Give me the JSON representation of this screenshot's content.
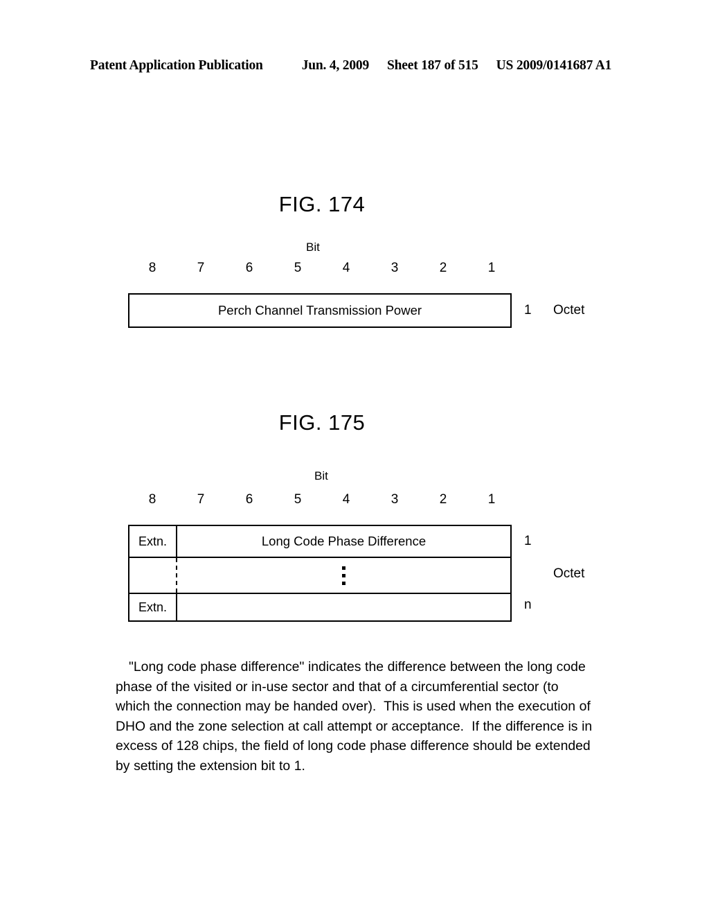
{
  "header": {
    "title": "Patent Application Publication",
    "date": "Jun. 4, 2009",
    "sheet": "Sheet 187 of 515",
    "patent_number": "US 2009/0141687 A1"
  },
  "figures": [
    {
      "id": "fig-174",
      "title": "FIG. 174",
      "bit_label": "Bit",
      "bit_numbers": [
        "8",
        "7",
        "6",
        "5",
        "4",
        "3",
        "2",
        "1"
      ],
      "rows": [
        {
          "extn": null,
          "body": "Perch Channel Transmission Power",
          "count": "1"
        }
      ],
      "octet_label": "Octet"
    },
    {
      "id": "fig-175",
      "title": "FIG. 175",
      "bit_label": "Bit",
      "bit_numbers": [
        "8",
        "7",
        "6",
        "5",
        "4",
        "3",
        "2",
        "1"
      ],
      "rows": [
        {
          "extn": "Extn.",
          "body": "Long Code Phase Difference",
          "count": "1"
        },
        {
          "extn": "",
          "body": "",
          "count": "",
          "ellipsis": true
        },
        {
          "extn": "Extn.",
          "body": "",
          "count": "n"
        }
      ],
      "octet_label": "Octet"
    }
  ],
  "body_paragraph": "\"Long code phase difference\" indicates the difference between the long code phase of the visited or in-use sector and that of a circumferential sector (to which the connection may be handed over).  This is used when the execution of DHO and the zone selection at call attempt or acceptance.  If the difference is in excess of 128 chips, the field of long code phase difference should be extended by setting the extension bit to 1."
}
